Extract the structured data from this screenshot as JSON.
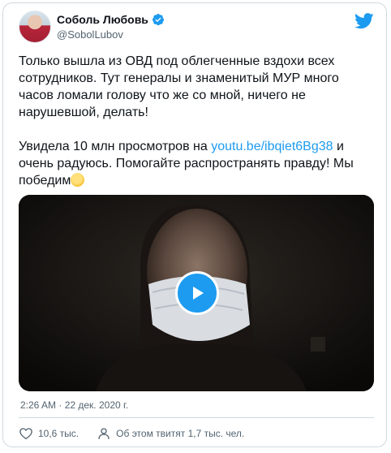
{
  "author": {
    "name": "Соболь Любовь",
    "handle": "@SobolLubov",
    "verified": true
  },
  "brand_color": "#1d9bf0",
  "tweet": {
    "paragraph1": "Только вышла из ОВД под облегченные вздохи всех сотрудников. Тут генералы и знаменитый МУР много часов ломали голову что же со мной, ничего не нарушевшой, делать!",
    "paragraph2_before": "Увидела 10 млн просмотров на ",
    "paragraph2_link": "youtu.be/ibqiet6Bg38",
    "paragraph2_after": " и очень радуюсь. Помогайте распространять правду! Мы победим",
    "emoji": "fist-emoji"
  },
  "media": {
    "type": "video",
    "play_icon": "play-icon"
  },
  "timestamp": "2:26 AM · 22 дек. 2020 г.",
  "actions": {
    "likes": "10,6 тыс.",
    "retweets_text": "Об этом твитят 1,7 тыс. чел."
  },
  "icons": {
    "verified": "verified-badge-icon",
    "brand": "twitter-bird-icon",
    "like": "heart-icon",
    "share": "person-icon"
  }
}
